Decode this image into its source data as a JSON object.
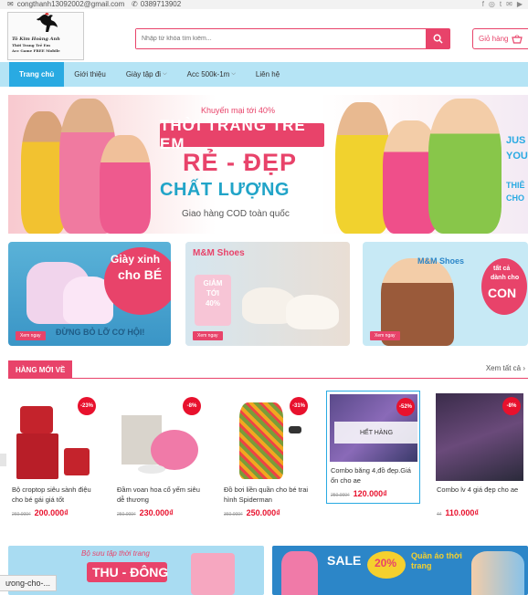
{
  "topbar": {
    "email": "congthanh13092002@gmail.com",
    "phone": "0389713902",
    "social_icons": [
      "facebook-icon",
      "instagram-icon",
      "twitter-icon",
      "youtube-icon",
      "mail-icon"
    ]
  },
  "logo": {
    "line1": "Tô Kim Hoàng Anh",
    "line2": "Thời Trang Trẻ Em",
    "line3": "Acc Game FREE Mobile"
  },
  "search": {
    "placeholder": "Nhập từ khóa tìm kiếm..."
  },
  "cart": {
    "label": "Giỏ hàng"
  },
  "nav": {
    "items": [
      {
        "label": "Trang chủ"
      },
      {
        "label": "Giới thiệu"
      },
      {
        "label": "Giày tập đi"
      },
      {
        "label": "Acc 500k-1m"
      },
      {
        "label": "Liên hệ"
      }
    ]
  },
  "hero": {
    "promo_top": "Khuyến mại tới 40%",
    "title": "THỜI TRANG TRẺ EM",
    "headline1": "RẺ - ĐẸP",
    "headline2": "CHẤT LƯỢNG",
    "sub": "Giao hàng COD toàn quốc",
    "side1": "JUS",
    "side2": "YOU",
    "side3": "THIÊ",
    "side4": "CHO"
  },
  "banners": [
    {
      "line1": "Giày xinh",
      "line2": "cho BÉ",
      "line3": "ĐỪNG BỎ LỠ CƠ HỘI!",
      "button": "Xem ngay"
    },
    {
      "brand": "M&M Shoes",
      "promo": "GIẢM TỚI 40%",
      "button": "Xem ngay"
    },
    {
      "brand": "M&M Shoes",
      "line1": "tất cả",
      "line2": "dành cho",
      "line3": "CON",
      "button": "Xem ngay"
    }
  ],
  "section": {
    "title": "HÀNG MỚI VỀ",
    "more": "Xem tất cả"
  },
  "products": [
    {
      "name": "Bộ croptop siêu sành điệu cho bé gái giá tốt",
      "old": "260.000₫",
      "new": "200.000₫",
      "discount": "-23%"
    },
    {
      "name": "Đầm voan hoa cổ yếm siêu dễ thương",
      "old": "250.000₫",
      "new": "230.000₫",
      "discount": "-8%"
    },
    {
      "name": "Đồ bơi liền quần cho bé trai hình Spiderman",
      "old": "360.000₫",
      "new": "250.000₫",
      "discount": "-31%"
    },
    {
      "name": "Combo băng 4,đồ đẹp.Giá ổn cho ae",
      "old": "250.000₫",
      "new": "120.000₫",
      "discount": "-52%",
      "soldout": "HẾT HÀNG"
    },
    {
      "name": "Combo lv 4 giá đẹp cho ae",
      "old": "4₫",
      "new": "110.000₫",
      "discount": "-8%"
    }
  ],
  "bottom_banners": [
    {
      "line1": "Bộ sưu tập thời trang",
      "line2": "THU - ĐÔNG"
    },
    {
      "line1": "SALE",
      "line2": "20%",
      "line3": "Quần áo thời trang"
    }
  ],
  "status_bar": {
    "text": "ưong-cho-..."
  },
  "colors": {
    "brand_pink": "#e8436a",
    "nav_bg": "#b5e4f5",
    "nav_active": "#29aae2",
    "price_red": "#e8112d"
  }
}
